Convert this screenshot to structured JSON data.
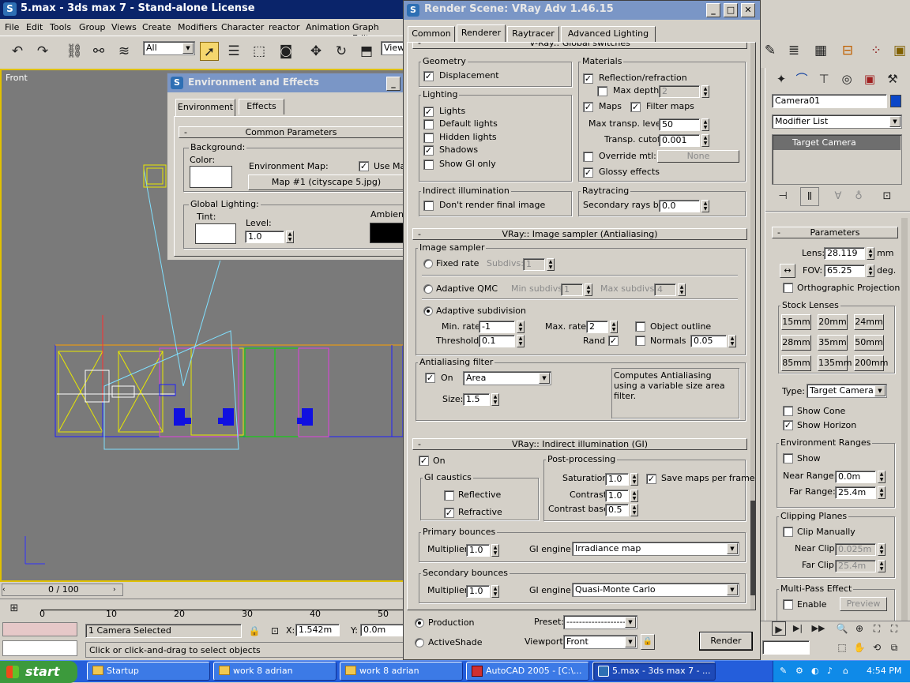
{
  "max_window": {
    "title": "5.max - 3ds max 7  - Stand-alone License",
    "menu": [
      "File",
      "Edit",
      "Tools",
      "Group",
      "Views",
      "Create",
      "Modifiers",
      "Character",
      "reactor",
      "Animation",
      "Graph Editors"
    ],
    "selection_filter": "All",
    "view_dropdown": "View",
    "viewport_label": "Front",
    "timeline": {
      "frame": "0 / 100",
      "ticks": [
        "0",
        "10",
        "20",
        "30",
        "40",
        "50"
      ]
    },
    "status": {
      "selected": "1 Camera Selected",
      "prompt": "Click or click-and-drag to select objects",
      "x_label": "X:",
      "x_value": "1.542m",
      "y_label": "Y:",
      "y_value": "0.0m"
    },
    "colors": {
      "title_active": "#0a246a",
      "viewport_bg": "#7a7a7a",
      "taskbar": "#245edb"
    }
  },
  "env_dialog": {
    "title": "Environment and Effects",
    "tabs": [
      "Environment",
      "Effects"
    ],
    "rollout": "Common Parameters",
    "background": {
      "group": "Background:",
      "color_label": "Color:",
      "map_label": "Environment Map:",
      "use_map": "Use Ma",
      "map_button": "Map #1 (cityscape 5.jpg)"
    },
    "global_lighting": {
      "group": "Global Lighting:",
      "tint": "Tint:",
      "level": "Level:",
      "level_value": "1.0",
      "ambient": "Ambient:"
    }
  },
  "render_dialog": {
    "title": "Render Scene: VRay Adv 1.46.15",
    "tabs": [
      "Common",
      "Renderer",
      "Raytracer",
      "Advanced Lighting"
    ],
    "global_switches": {
      "header": "V-Ray:: Global switches",
      "geometry": {
        "label": "Geometry",
        "displacement": "Displacement"
      },
      "lighting": {
        "label": "Lighting",
        "items": [
          "Lights",
          "Default lights",
          "Hidden lights",
          "Shadows",
          "Show GI only"
        ]
      },
      "materials": {
        "label": "Materials",
        "reflection": "Reflection/refraction",
        "max_depth": "Max depth",
        "max_depth_value": "2",
        "maps": "Maps",
        "filter_maps": "Filter maps",
        "max_transp": "Max transp. levels",
        "max_transp_value": "50",
        "transp_cutoff": "Transp. cutoff",
        "transp_cutoff_value": "0.001",
        "override_mtl": "Override mtl:",
        "none": "None",
        "glossy": "Glossy effects"
      },
      "indirect": {
        "label": "Indirect illumination",
        "dont_render": "Don't render final image"
      },
      "raytracing": {
        "label": "Raytracing",
        "secondary_bias": "Secondary rays bias",
        "secondary_bias_value": "0.0"
      }
    },
    "image_sampler": {
      "header": "VRay:: Image sampler (Antialiasing)",
      "label": "Image sampler",
      "fixed_rate": "Fixed rate",
      "subdivs": "Subdivs:",
      "subdivs_value": "1",
      "adaptive_qmc": "Adaptive QMC",
      "min_subdivs": "Min subdivs:",
      "min_subdivs_value": "1",
      "max_subdivs": "Max subdivs:",
      "max_subdivs_value": "4",
      "adaptive_subdivision": "Adaptive subdivision",
      "min_rate": "Min. rate:",
      "min_rate_value": "-1",
      "max_rate": "Max. rate:",
      "max_rate_value": "2",
      "object_outline": "Object outline",
      "threshold": "Threshold:",
      "threshold_value": "0.1",
      "rand": "Rand",
      "normals": "Normals",
      "normals_value": "0.05",
      "aa_filter": "Antialiasing filter",
      "on": "On",
      "filter_type": "Area",
      "size": "Size:",
      "size_value": "1.5",
      "description": "Computes Antialiasing using a variable size area filter."
    },
    "gi": {
      "header": "VRay:: Indirect illumination (GI)",
      "on": "On",
      "caustics": "GI caustics",
      "reflective": "Reflective",
      "refractive": "Refractive",
      "post": "Post-processing",
      "saturation": "Saturation:",
      "saturation_value": "1.0",
      "save_maps": "Save maps per frame",
      "contrast": "Contrast:",
      "contrast_value": "1.0",
      "contrast_base": "Contrast base:",
      "contrast_base_value": "0.5",
      "primary": "Primary bounces",
      "multiplier": "Multiplier:",
      "primary_mult": "1.0",
      "gi_engine": "GI engine:",
      "primary_engine": "Irradiance map",
      "secondary": "Secondary bounces",
      "secondary_mult": "1.0",
      "secondary_engine": "Quasi-Monte Carlo"
    },
    "bottom": {
      "production": "Production",
      "activeshade": "ActiveShade",
      "preset": "Preset:",
      "preset_value": "--------------------",
      "viewport": "Viewport:",
      "viewport_value": "Front",
      "render": "Render"
    }
  },
  "command_panel": {
    "object_name": "Camera01",
    "modifier_list": "Modifier List",
    "stack_item": "Target Camera",
    "parameters": "Parameters",
    "lens": "Lens:",
    "lens_value": "28.119",
    "lens_unit": "mm",
    "fov": "FOV:",
    "fov_value": "65.25",
    "fov_unit": "deg.",
    "ortho": "Orthographic Projection",
    "stock_lenses": "Stock Lenses",
    "lenses": [
      "15mm",
      "20mm",
      "24mm",
      "28mm",
      "35mm",
      "50mm",
      "85mm",
      "135mm",
      "200mm"
    ],
    "type": "Type:",
    "type_value": "Target Camera",
    "show_cone": "Show Cone",
    "show_horizon": "Show Horizon",
    "env_ranges": "Environment Ranges",
    "show": "Show",
    "near_range": "Near Range:",
    "near_range_value": "0.0m",
    "far_range": "Far Range:",
    "far_range_value": "25.4m",
    "clipping": "Clipping Planes",
    "clip_manually": "Clip Manually",
    "near_clip": "Near Clip:",
    "near_clip_value": "0.025m",
    "far_clip": "Far Clip:",
    "far_clip_value": "25.4m",
    "multipass": "Multi-Pass Effect",
    "enable": "Enable",
    "preview": "Preview"
  },
  "taskbar": {
    "start": "start",
    "items": [
      "Startup",
      "work 8 adrian",
      "work 8 adrian",
      "AutoCAD 2005 - [C:\\...",
      "5.max - 3ds max 7  - ..."
    ],
    "clock": "4:54 PM"
  }
}
